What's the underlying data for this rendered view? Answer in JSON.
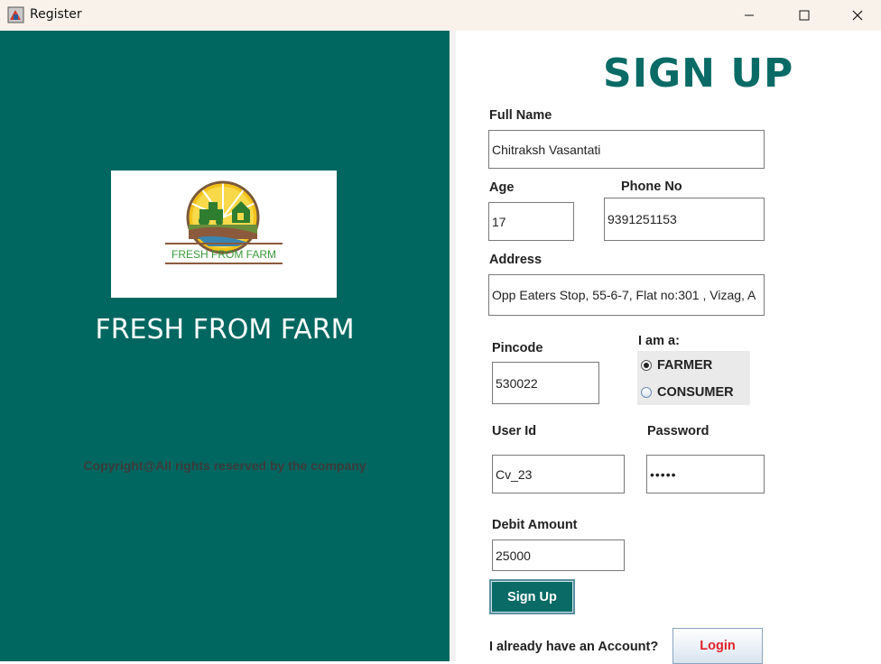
{
  "window": {
    "title": "Register",
    "icons": {
      "app": "app-icon",
      "minimize": "minimize-icon",
      "maximize": "maximize-icon",
      "close": "close-icon"
    }
  },
  "left_panel": {
    "logo_text": "FRESH FROM FARM",
    "brand_title": "FRESH FROM FARM",
    "copyright": "Copyright@All rights reserved by the company",
    "background_color": "#006760"
  },
  "form": {
    "heading": "SIGN UP",
    "full_name": {
      "label": "Full Name",
      "value": "Chitraksh Vasantati"
    },
    "age": {
      "label": "Age",
      "value": "17"
    },
    "phone": {
      "label": "Phone No",
      "value": "9391251153"
    },
    "address": {
      "label": "Address",
      "value": "Opp Eaters Stop, 55-6-7, Flat no:301 , Vizag, A"
    },
    "pincode": {
      "label": "Pincode",
      "value": "530022"
    },
    "role": {
      "label": "I am a:",
      "options": [
        {
          "label": "FARMER",
          "selected": true
        },
        {
          "label": "CONSUMER",
          "selected": false
        }
      ]
    },
    "user_id": {
      "label": "User Id",
      "value": "Cv_23"
    },
    "password": {
      "label": "Password",
      "value": "•••••"
    },
    "debit_amount": {
      "label": "Debit Amount",
      "value": "25000"
    },
    "signup_button": "Sign Up",
    "have_account_text": "I already have an Account?",
    "login_button": "Login",
    "accent_color": "#0a6b66",
    "login_text_color": "#e0202a"
  }
}
